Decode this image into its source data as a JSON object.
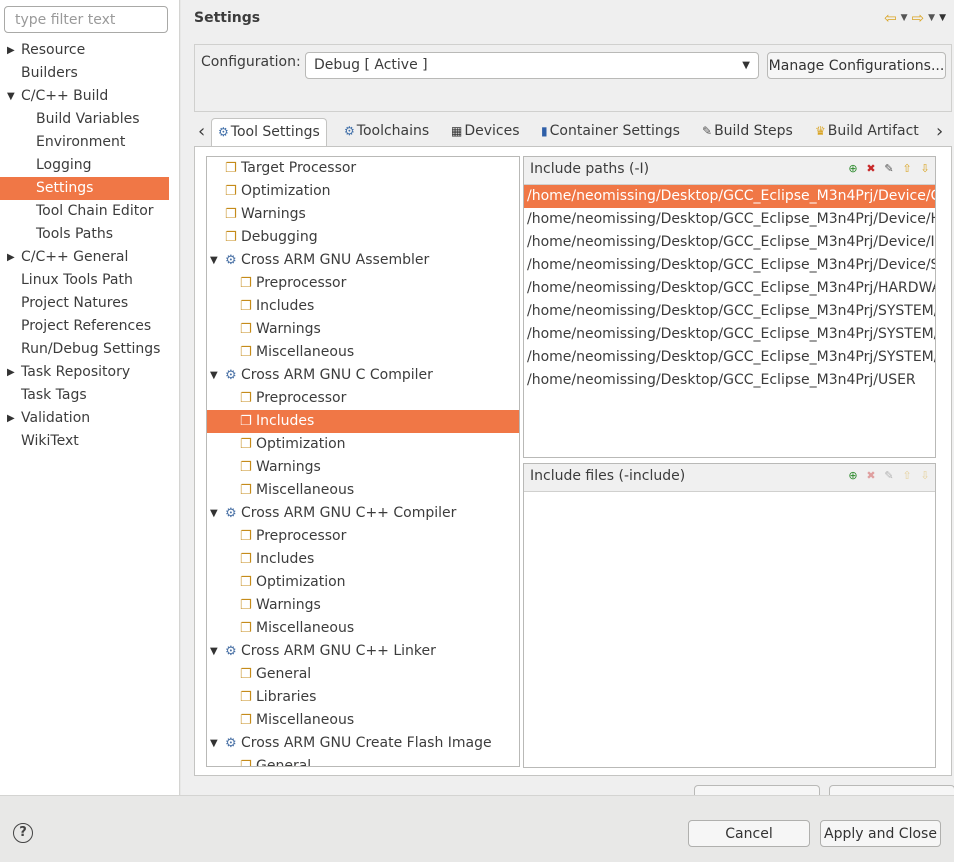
{
  "filter": {
    "placeholder": "type filter text"
  },
  "nav": {
    "items": [
      {
        "label": "Resource",
        "arrow": "▶",
        "indent": 0
      },
      {
        "label": "Builders",
        "arrow": "",
        "indent": 0
      },
      {
        "label": "C/C++ Build",
        "arrow": "▼",
        "indent": 0
      },
      {
        "label": "Build Variables",
        "arrow": "",
        "indent": 1
      },
      {
        "label": "Environment",
        "arrow": "",
        "indent": 1
      },
      {
        "label": "Logging",
        "arrow": "",
        "indent": 1
      },
      {
        "label": "Settings",
        "arrow": "",
        "indent": 1,
        "selected": true
      },
      {
        "label": "Tool Chain Editor",
        "arrow": "",
        "indent": 1
      },
      {
        "label": "Tools Paths",
        "arrow": "",
        "indent": 1
      },
      {
        "label": "C/C++ General",
        "arrow": "▶",
        "indent": 0
      },
      {
        "label": "Linux Tools Path",
        "arrow": "",
        "indent": 0
      },
      {
        "label": "Project Natures",
        "arrow": "",
        "indent": 0
      },
      {
        "label": "Project References",
        "arrow": "",
        "indent": 0
      },
      {
        "label": "Run/Debug Settings",
        "arrow": "",
        "indent": 0
      },
      {
        "label": "Task Repository",
        "arrow": "▶",
        "indent": 0
      },
      {
        "label": "Task Tags",
        "arrow": "",
        "indent": 0
      },
      {
        "label": "Validation",
        "arrow": "▶",
        "indent": 0
      },
      {
        "label": "WikiText",
        "arrow": "",
        "indent": 0
      }
    ]
  },
  "header": {
    "title": "Settings"
  },
  "config": {
    "label": "Configuration:",
    "selected": "Debug  [ Active ]",
    "manage_label": "Manage Configurations..."
  },
  "tabs": [
    {
      "label": "Tool Settings",
      "icon": "tool-settings-icon",
      "active": true
    },
    {
      "label": "Toolchains",
      "icon": "toolchains-icon"
    },
    {
      "label": "Devices",
      "icon": "devices-icon"
    },
    {
      "label": "Container Settings",
      "icon": "container-icon"
    },
    {
      "label": "Build Steps",
      "icon": "build-steps-icon"
    },
    {
      "label": "Build Artifact",
      "icon": "build-artifact-icon"
    }
  ],
  "settings_tree": [
    {
      "label": "Target Processor",
      "level": 0,
      "icon": "page"
    },
    {
      "label": "Optimization",
      "level": 0,
      "icon": "page"
    },
    {
      "label": "Warnings",
      "level": 0,
      "icon": "page"
    },
    {
      "label": "Debugging",
      "level": 0,
      "icon": "page"
    },
    {
      "label": "Cross ARM GNU Assembler",
      "level": 0,
      "icon": "gear",
      "expanded": true
    },
    {
      "label": "Preprocessor",
      "level": 1,
      "icon": "page"
    },
    {
      "label": "Includes",
      "level": 1,
      "icon": "page"
    },
    {
      "label": "Warnings",
      "level": 1,
      "icon": "page"
    },
    {
      "label": "Miscellaneous",
      "level": 1,
      "icon": "page"
    },
    {
      "label": "Cross ARM GNU C Compiler",
      "level": 0,
      "icon": "gear",
      "expanded": true
    },
    {
      "label": "Preprocessor",
      "level": 1,
      "icon": "page"
    },
    {
      "label": "Includes",
      "level": 1,
      "icon": "page",
      "selected": true
    },
    {
      "label": "Optimization",
      "level": 1,
      "icon": "page"
    },
    {
      "label": "Warnings",
      "level": 1,
      "icon": "page"
    },
    {
      "label": "Miscellaneous",
      "level": 1,
      "icon": "page"
    },
    {
      "label": "Cross ARM GNU C++ Compiler",
      "level": 0,
      "icon": "gear",
      "expanded": true
    },
    {
      "label": "Preprocessor",
      "level": 1,
      "icon": "page"
    },
    {
      "label": "Includes",
      "level": 1,
      "icon": "page"
    },
    {
      "label": "Optimization",
      "level": 1,
      "icon": "page"
    },
    {
      "label": "Warnings",
      "level": 1,
      "icon": "page"
    },
    {
      "label": "Miscellaneous",
      "level": 1,
      "icon": "page"
    },
    {
      "label": "Cross ARM GNU C++ Linker",
      "level": 0,
      "icon": "gear",
      "expanded": true
    },
    {
      "label": "General",
      "level": 1,
      "icon": "page"
    },
    {
      "label": "Libraries",
      "level": 1,
      "icon": "page"
    },
    {
      "label": "Miscellaneous",
      "level": 1,
      "icon": "page"
    },
    {
      "label": "Cross ARM GNU Create Flash Image",
      "level": 0,
      "icon": "gear",
      "expanded": true
    },
    {
      "label": "General",
      "level": 1,
      "icon": "page"
    }
  ],
  "include_paths": {
    "header": "Include paths (-I)",
    "items": [
      "/home/neomissing/Desktop/GCC_Eclipse_M3n4Prj/Device/CMSIS",
      "/home/neomissing/Desktop/GCC_Eclipse_M3n4Prj/Device/HAL",
      "/home/neomissing/Desktop/GCC_Eclipse_M3n4Prj/Device/Include",
      "/home/neomissing/Desktop/GCC_Eclipse_M3n4Prj/Device/Source",
      "/home/neomissing/Desktop/GCC_Eclipse_M3n4Prj/HARDWARE",
      "/home/neomissing/Desktop/GCC_Eclipse_M3n4Prj/SYSTEM/delay",
      "/home/neomissing/Desktop/GCC_Eclipse_M3n4Prj/SYSTEM/sys",
      "/home/neomissing/Desktop/GCC_Eclipse_M3n4Prj/SYSTEM/usart",
      "/home/neomissing/Desktop/GCC_Eclipse_M3n4Prj/USER"
    ]
  },
  "include_files": {
    "header": "Include files (-include)",
    "items": []
  },
  "footer": {
    "cancel_label": "Cancel",
    "apply_close_label": "Apply and Close",
    "help_glyph": "?"
  }
}
